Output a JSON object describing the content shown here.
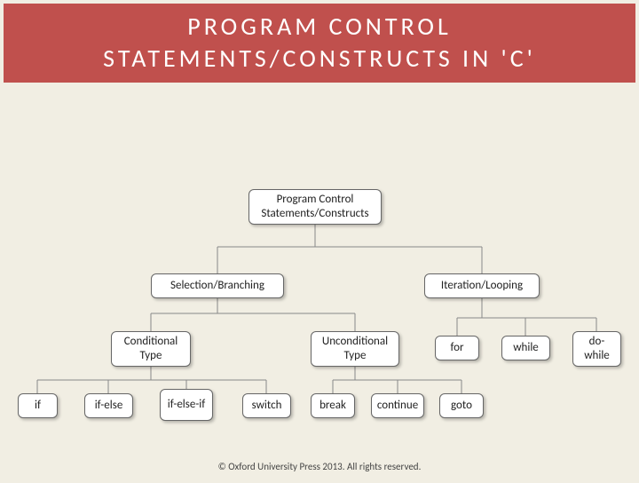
{
  "title": "PROGRAM CONTROL STATEMENTS/CONSTRUCTS IN 'C'",
  "nodes": {
    "root": "Program Control Statements/Constructs",
    "sel": "Selection/Branching",
    "iter": "Iteration/Looping",
    "cond": "Conditional Type",
    "uncond": "Unconditional Type",
    "for": "for",
    "while": "while",
    "dowhile": "do-while",
    "if": "if",
    "ifelse": "if-else",
    "ifelseif": "if-else-if",
    "switch": "switch",
    "break": "break",
    "continue": "continue",
    "goto": "goto"
  },
  "footer": "© Oxford University Press 2013. All rights reserved.",
  "chart_data": {
    "type": "tree",
    "root": "Program Control Statements/Constructs",
    "children": [
      {
        "label": "Selection/Branching",
        "children": [
          {
            "label": "Conditional Type",
            "children": [
              {
                "label": "if"
              },
              {
                "label": "if-else"
              },
              {
                "label": "if-else-if"
              },
              {
                "label": "switch"
              }
            ]
          },
          {
            "label": "Unconditional Type",
            "children": [
              {
                "label": "break"
              },
              {
                "label": "continue"
              },
              {
                "label": "goto"
              }
            ]
          }
        ]
      },
      {
        "label": "Iteration/Looping",
        "children": [
          {
            "label": "for"
          },
          {
            "label": "while"
          },
          {
            "label": "do-while"
          }
        ]
      }
    ]
  }
}
